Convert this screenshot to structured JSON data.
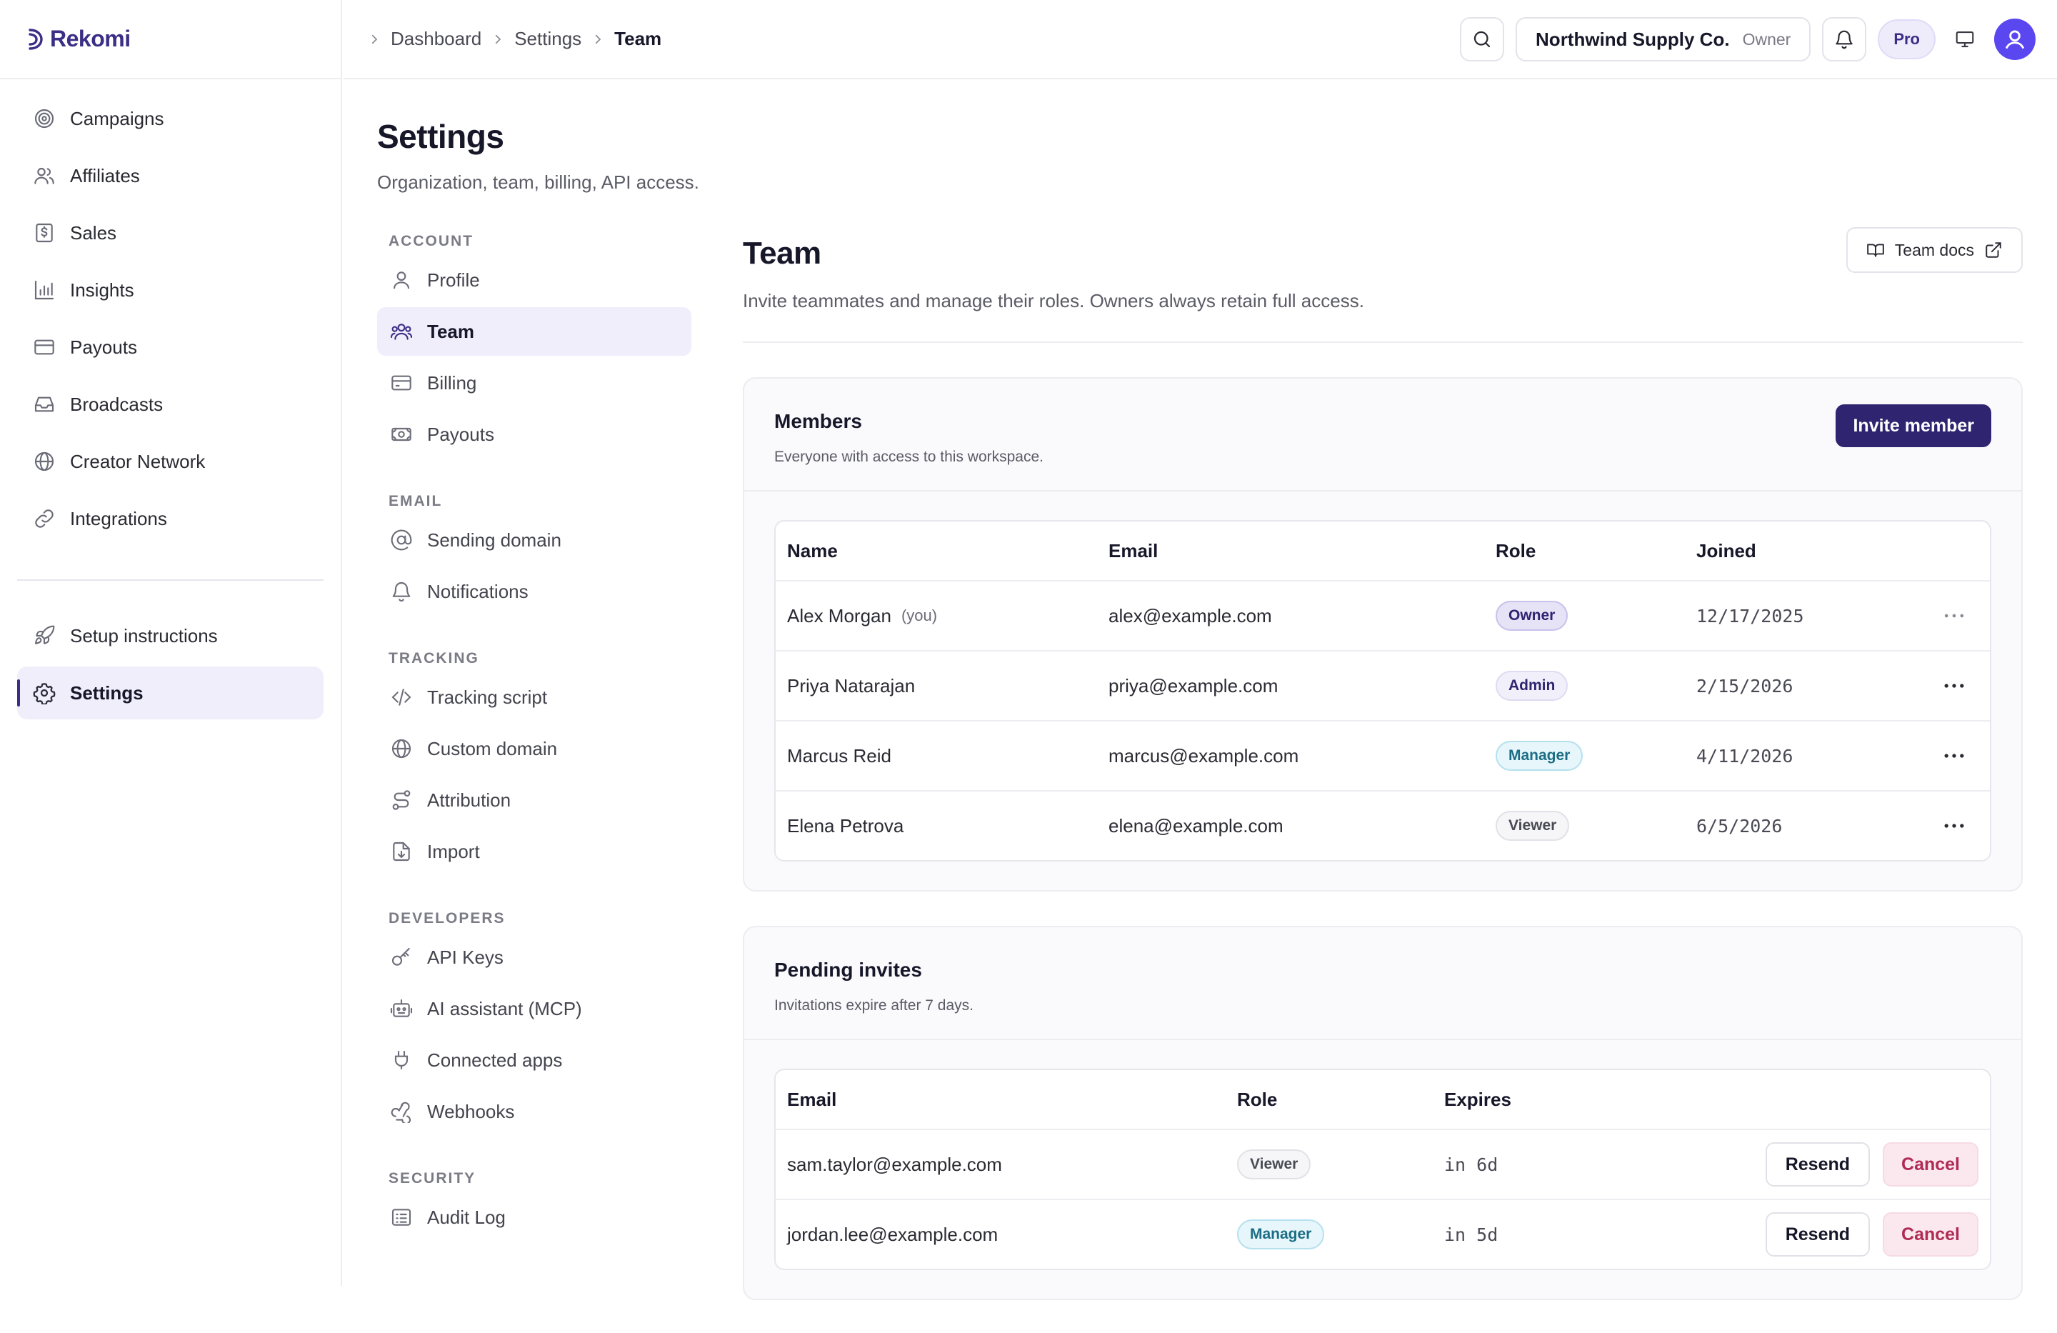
{
  "brand": {
    "name": "Rekomi",
    "logo_icon": "crescent-logo-icon"
  },
  "sidebar": {
    "items": [
      {
        "label": "Campaigns",
        "icon": "target-icon"
      },
      {
        "label": "Affiliates",
        "icon": "users-icon"
      },
      {
        "label": "Sales",
        "icon": "receipt-dollar-icon"
      },
      {
        "label": "Insights",
        "icon": "bar-chart-icon"
      },
      {
        "label": "Payouts",
        "icon": "card-icon"
      },
      {
        "label": "Broadcasts",
        "icon": "inbox-icon"
      },
      {
        "label": "Creator Network",
        "icon": "globe-icon"
      },
      {
        "label": "Integrations",
        "icon": "link-icon"
      }
    ],
    "bottom_items": [
      {
        "label": "Setup instructions",
        "icon": "rocket-icon"
      },
      {
        "label": "Settings",
        "icon": "gear-icon",
        "active": true
      }
    ]
  },
  "topbar": {
    "breadcrumb": [
      "Dashboard",
      "Settings",
      "Team"
    ],
    "org_name": "Northwind Supply Co.",
    "org_role": "Owner",
    "plan": "Pro"
  },
  "settings": {
    "title": "Settings",
    "subtitle": "Organization, team, billing, API access.",
    "sections": {
      "account": {
        "label": "ACCOUNT",
        "items": [
          {
            "label": "Profile",
            "icon": "user-icon"
          },
          {
            "label": "Team",
            "icon": "users-icon",
            "active": true
          },
          {
            "label": "Billing",
            "icon": "card-icon"
          },
          {
            "label": "Payouts",
            "icon": "money-icon"
          }
        ]
      },
      "email": {
        "label": "EMAIL",
        "items": [
          {
            "label": "Sending domain",
            "icon": "at-sign-icon"
          },
          {
            "label": "Notifications",
            "icon": "bell-icon"
          }
        ]
      },
      "tracking": {
        "label": "TRACKING",
        "items": [
          {
            "label": "Tracking script",
            "icon": "code-icon"
          },
          {
            "label": "Custom domain",
            "icon": "globe-icon"
          },
          {
            "label": "Attribution",
            "icon": "route-icon"
          },
          {
            "label": "Import",
            "icon": "file-import-icon"
          }
        ]
      },
      "developers": {
        "label": "DEVELOPERS",
        "items": [
          {
            "label": "API Keys",
            "icon": "key-icon"
          },
          {
            "label": "AI assistant (MCP)",
            "icon": "robot-icon"
          },
          {
            "label": "Connected apps",
            "icon": "plug-icon"
          },
          {
            "label": "Webhooks",
            "icon": "webhook-icon"
          }
        ]
      },
      "security": {
        "label": "SECURITY",
        "items": [
          {
            "label": "Audit Log",
            "icon": "list-icon"
          }
        ]
      }
    }
  },
  "team": {
    "title": "Team",
    "description": "Invite teammates and manage their roles. Owners always retain full access.",
    "docs_label": "Team docs"
  },
  "members": {
    "title": "Members",
    "subtitle": "Everyone with access to this workspace.",
    "invite_label": "Invite member",
    "columns": {
      "name": "Name",
      "email": "Email",
      "role": "Role",
      "joined": "Joined"
    },
    "you_tag": "(you)",
    "rows": [
      {
        "name": "Alex Morgan",
        "email": "alex@example.com",
        "role": "Owner",
        "joined": "12/17/2025"
      },
      {
        "name": "Priya Natarajan",
        "email": "priya@example.com",
        "role": "Admin",
        "joined": "2/15/2026"
      },
      {
        "name": "Marcus Reid",
        "email": "marcus@example.com",
        "role": "Manager",
        "joined": "4/11/2026"
      },
      {
        "name": "Elena Petrova",
        "email": "elena@example.com",
        "role": "Viewer",
        "joined": "6/5/2026"
      }
    ]
  },
  "invites": {
    "title": "Pending invites",
    "subtitle": "Invitations expire after 7 days.",
    "columns": {
      "email": "Email",
      "role": "Role",
      "expires": "Expires"
    },
    "resend_label": "Resend",
    "cancel_label": "Cancel",
    "rows": [
      {
        "email": "sam.taylor@example.com",
        "role": "Viewer",
        "expires": "in 6d"
      },
      {
        "email": "jordan.lee@example.com",
        "role": "Manager",
        "expires": "in 5d"
      }
    ]
  },
  "colors": {
    "brand": "#3b2e86",
    "primary_button": "#2f2470",
    "danger_text": "#b02a56",
    "active_bg": "#f0eefb",
    "avatar": "#5b47f0"
  }
}
